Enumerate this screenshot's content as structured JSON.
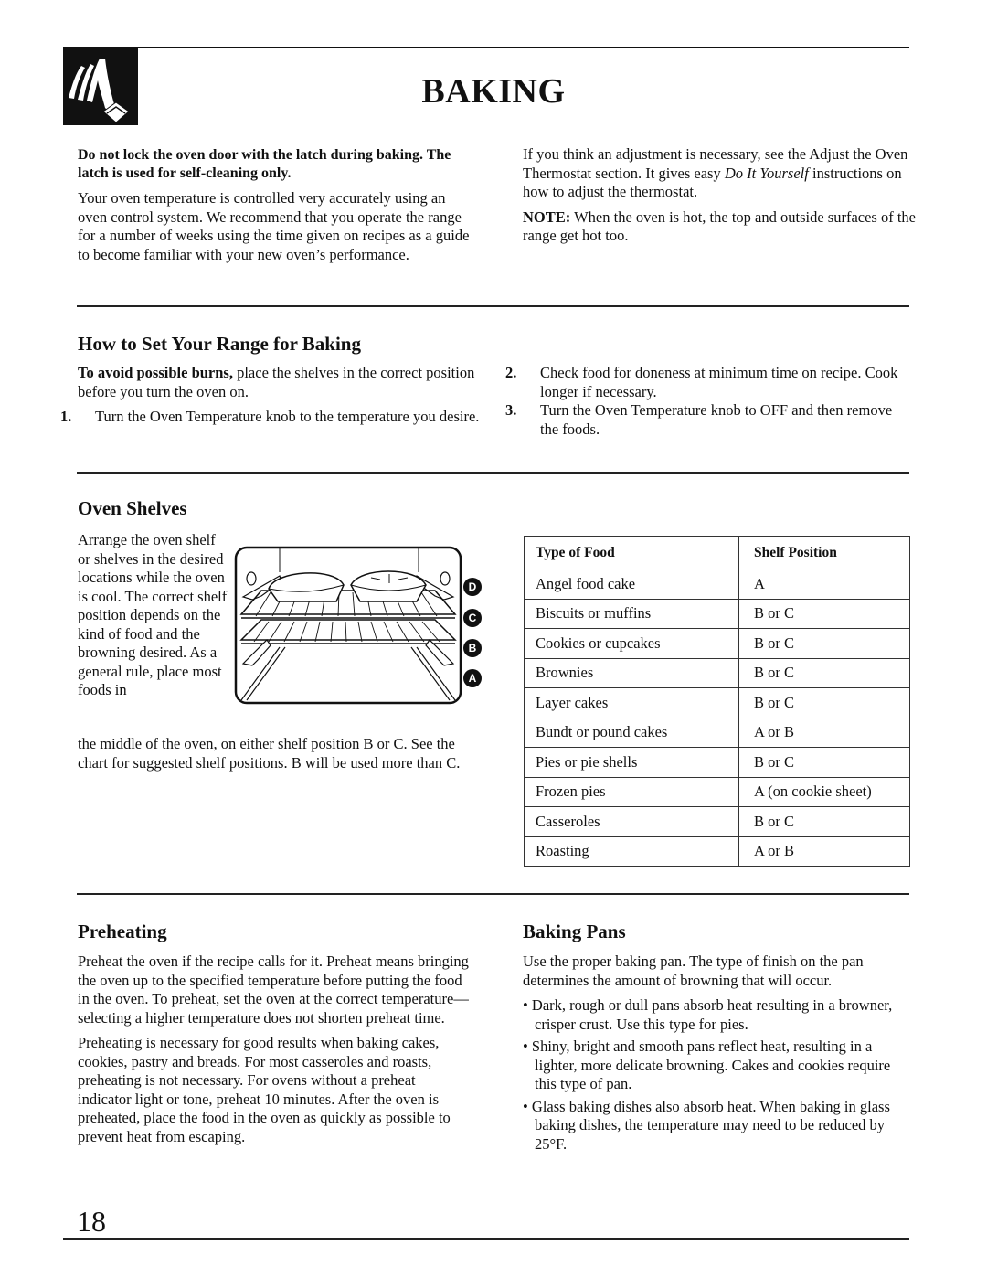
{
  "header": {
    "title": "BAKING",
    "logo_icon": "hand-pressing-button-icon"
  },
  "intro": {
    "warning": "Do not lock the oven door with the latch during baking. The latch is used for self-cleaning only.",
    "paragraph": "Your oven temperature is controlled very accurately using an oven control system. We recommend that you operate the range for a number of weeks using the time given on recipes as a guide to become familiar with your new oven’s performance.",
    "adjust_before": "If you think an adjustment is necessary, see the Adjust the Oven Thermostat section. It gives easy ",
    "adjust_italic": "Do It Yourself",
    "adjust_after": " instructions on how to adjust the thermostat.",
    "note_label": "NOTE:",
    "note_text": " When the oven is hot, the top and outside surfaces of the range get hot too."
  },
  "how_to_set": {
    "heading": "How to Set Your Range for Baking",
    "caution_bold": "To avoid possible burns,",
    "caution_text": " place the shelves in the correct position before you turn the oven on.",
    "steps": [
      {
        "num": "1.",
        "text": "Turn the Oven Temperature knob to the temperature you desire."
      },
      {
        "num": "2.",
        "text": "Check food for doneness at minimum time on recipe. Cook longer if necessary."
      },
      {
        "num": "3.",
        "text": "Turn the Oven Temperature knob to OFF and then remove the foods."
      }
    ]
  },
  "oven_shelves": {
    "heading": "Oven Shelves",
    "text_side": "Arrange the oven shelf or shelves in the desired locations while the oven is cool. The correct shelf position depends on the kind of food and the browning desired. As a general rule, place most foods in",
    "text_full": "the middle of the oven, on either shelf position B or C. See the chart for suggested shelf positions. B will be used more than C.",
    "positions": [
      "D",
      "C",
      "B",
      "A"
    ],
    "table": {
      "headers": [
        "Type of Food",
        "Shelf Position"
      ],
      "rows": [
        [
          "Angel food cake",
          "A"
        ],
        [
          "Biscuits or muffins",
          "B or C"
        ],
        [
          "Cookies or cupcakes",
          "B or C"
        ],
        [
          "Brownies",
          "B or C"
        ],
        [
          "Layer cakes",
          "B or C"
        ],
        [
          "Bundt or pound cakes",
          "A or B"
        ],
        [
          "Pies or pie shells",
          "B or C"
        ],
        [
          "Frozen pies",
          "A (on cookie sheet)"
        ],
        [
          "Casseroles",
          "B or C"
        ],
        [
          "Roasting",
          "A or B"
        ]
      ]
    }
  },
  "preheating": {
    "heading": "Preheating",
    "p1": "Preheat the oven if the recipe calls for it. Preheat means bringing the oven up to the specified temperature before putting the food in the oven. To preheat, set the oven at the correct temperature—selecting a higher temperature does not shorten preheat time.",
    "p2": "Preheating is necessary for good results when baking cakes, cookies, pastry and breads. For most casseroles and roasts, preheating is not necessary. For ovens without a preheat indicator light or tone, preheat 10 minutes. After the oven is preheated, place the food in the oven as quickly as possible to prevent heat from escaping."
  },
  "baking_pans": {
    "heading": "Baking Pans",
    "intro": "Use the proper baking pan. The type of finish on the pan determines the amount of browning that will occur.",
    "bullets": [
      "Dark, rough or dull pans absorb heat resulting in a browner, crisper crust. Use this type for pies.",
      "Shiny, bright and smooth pans reflect heat, resulting in a lighter, more delicate browning. Cakes and cookies require this type of pan.",
      "Glass baking dishes also absorb heat. When baking in glass baking dishes, the temperature may need to be reduced by 25°F."
    ]
  },
  "footer": {
    "page_number": "18"
  }
}
